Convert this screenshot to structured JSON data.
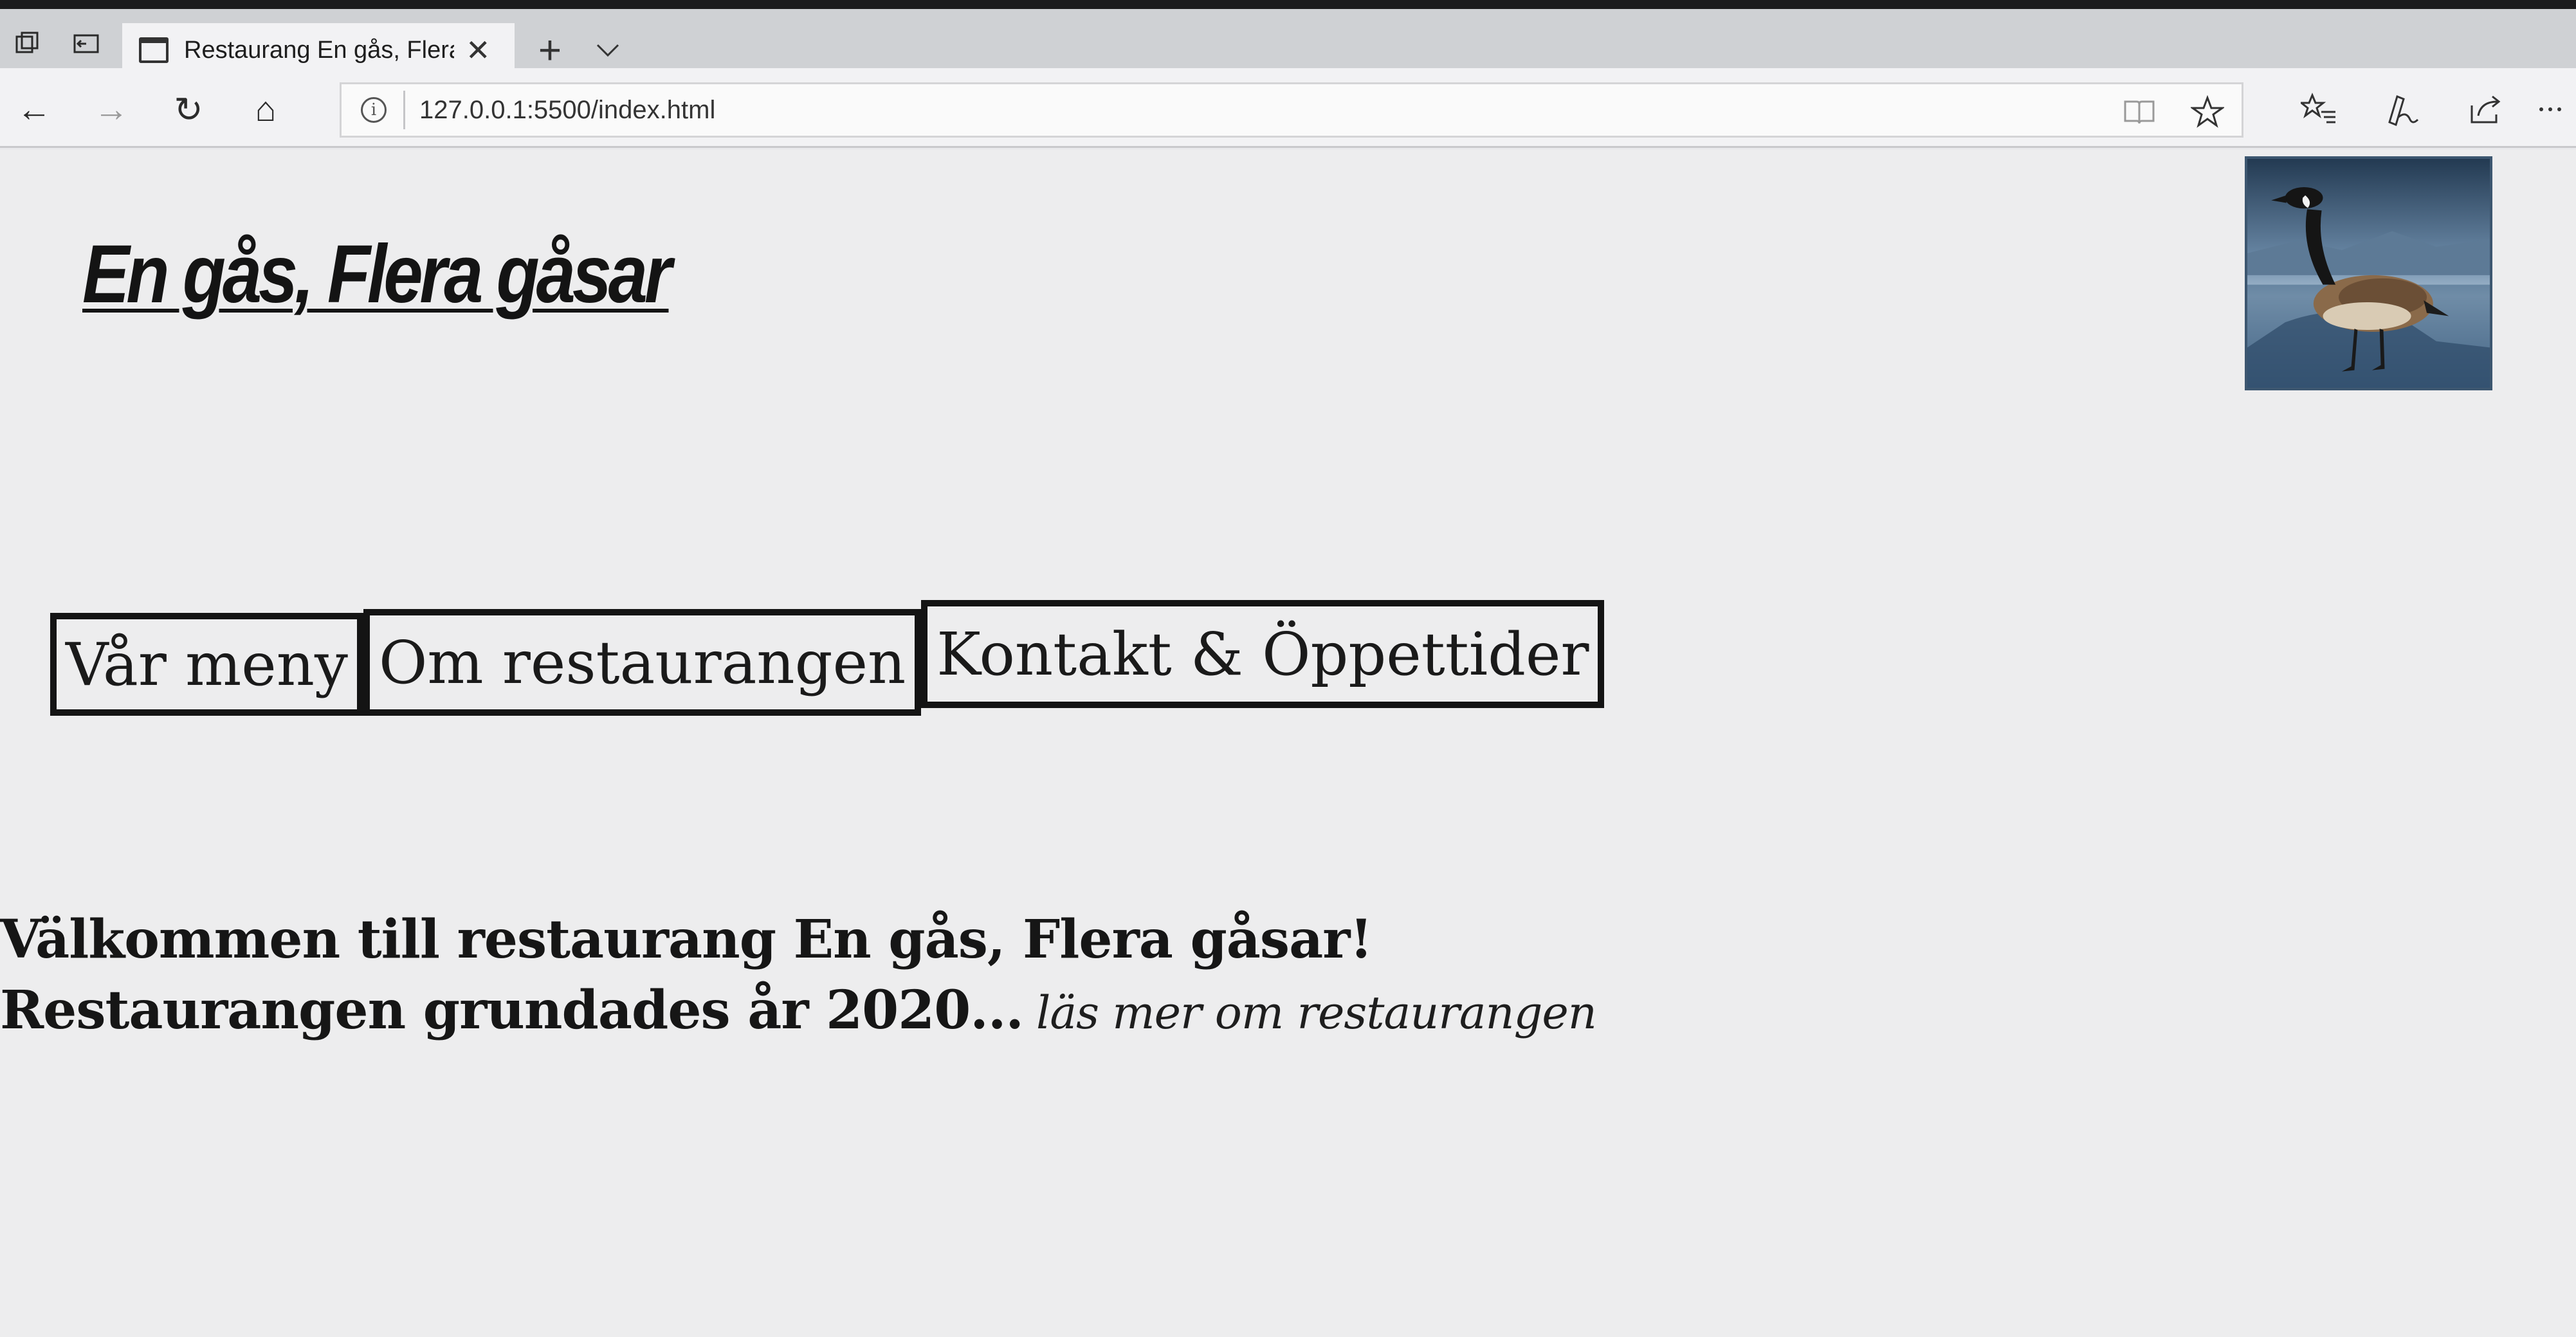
{
  "browser": {
    "tab": {
      "title": "Restaurang En gås, Flera gåsar",
      "close_glyph": "✕"
    },
    "newtab_glyph": "+",
    "tablist_glyph": "⌄",
    "nav": {
      "back_glyph": "←",
      "forward_glyph": "→",
      "refresh_glyph": "↻",
      "home_glyph": "⌂"
    },
    "address": {
      "url": "127.0.0.1:5500/index.html",
      "info_glyph": "i"
    },
    "icons": {
      "reading_view": "reading-view-icon",
      "favorite": "star-icon",
      "favorites_hub": "favorites-list-icon",
      "notes": "pen-icon",
      "share": "share-icon",
      "more": "more-icon"
    }
  },
  "page": {
    "site_title": "En gås, Flera gåsar",
    "logo_image": "goose-image",
    "menu": [
      {
        "label": "Vår meny"
      },
      {
        "label": "Om restaurangen"
      },
      {
        "label": "Kontakt & Öppettider"
      }
    ],
    "welcome": "Välkommen till restaurang En gås, Flera gåsar!",
    "founded": "Restaurangen grundades år 2020...",
    "read_more": "läs mer om restaurangen"
  },
  "colors": {
    "page_bg": "#ededee",
    "text": "#161616",
    "menu_border": "#141414",
    "chrome_bg": "#f2f2f4",
    "tabbar_bg": "#cfd1d4"
  }
}
